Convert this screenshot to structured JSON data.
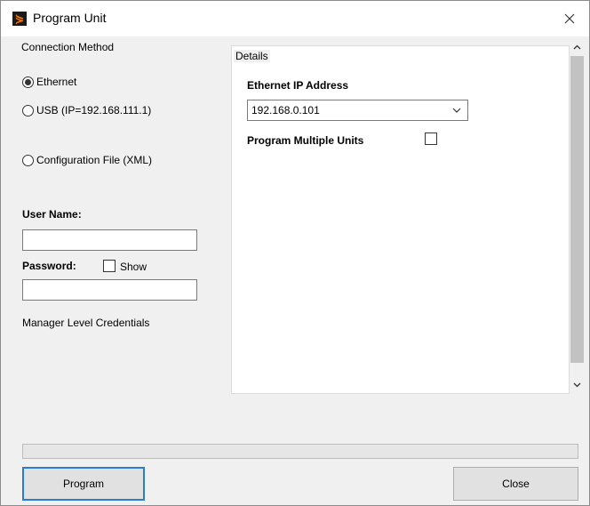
{
  "window": {
    "title": "Program Unit",
    "close_glyph": "✕",
    "app_icon": "program-unit-logo"
  },
  "connection": {
    "group_label": "Connection Method",
    "options": [
      "Ethernet",
      "USB (IP=192.168.111.1)",
      "Configuration File (XML)"
    ],
    "selected": "Ethernet"
  },
  "credentials": {
    "user_name_label": "User Name:",
    "user_name_value": "",
    "password_label": "Password:",
    "password_value": "",
    "show_label": "Show",
    "show_checked": false,
    "note": "Manager Level Credentials"
  },
  "details": {
    "group_label": "Details",
    "ip_label": "Ethernet IP Address",
    "ip_value": "192.168.0.101",
    "multi_label": "Program Multiple Units",
    "multi_checked": false
  },
  "progress": {
    "value": 0
  },
  "buttons": {
    "program": "Program",
    "close": "Close"
  },
  "colors": {
    "focus_border": "#2a7bd2",
    "icon_bg": "#1a1a1a",
    "icon_fg": "#ff7a00"
  }
}
